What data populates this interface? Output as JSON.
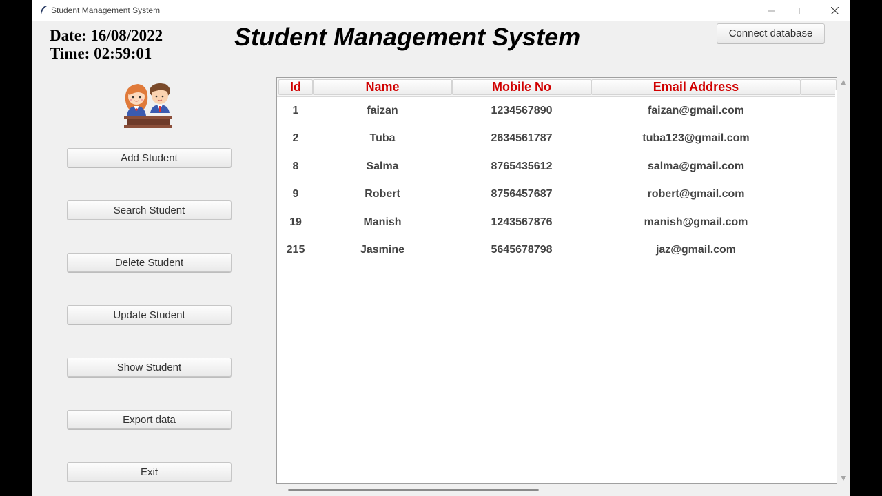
{
  "window": {
    "title": "Student Management System",
    "icons": {
      "app": "feather-icon",
      "minimize": "minimize-icon",
      "maximize": "maximize-icon",
      "close": "close-icon"
    }
  },
  "header": {
    "date": "Date: 16/08/2022",
    "time": "Time: 02:59:01",
    "title": "Student Management System",
    "connect_label": "Connect database"
  },
  "sidebar": {
    "avatar_icon": "students-illustration-icon",
    "buttons": [
      "Add Student",
      "Search Student",
      "Delete Student",
      "Update Student",
      "Show Student",
      "Export data",
      "Exit"
    ]
  },
  "table": {
    "columns": [
      "Id",
      "Name",
      "Mobile No",
      "Email Address"
    ],
    "header_color": "#d00000",
    "rows": [
      [
        "1",
        "faizan",
        "1234567890",
        "faizan@gmail.com"
      ],
      [
        "2",
        "Tuba",
        "2634561787",
        "tuba123@gmail.com"
      ],
      [
        "8",
        "Salma",
        "8765435612",
        "salma@gmail.com"
      ],
      [
        "9",
        "Robert",
        "8756457687",
        "robert@gmail.com"
      ],
      [
        "19",
        "Manish",
        "1243567876",
        "manish@gmail.com"
      ],
      [
        "215",
        "Jasmine",
        "5645678798",
        "jaz@gmail.com"
      ]
    ]
  }
}
